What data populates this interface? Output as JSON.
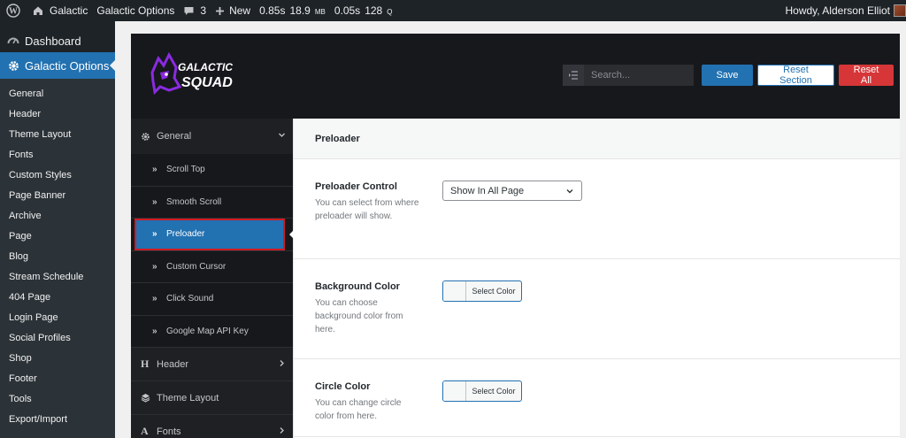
{
  "adminbar": {
    "site_name": "Galactic",
    "options_label": "Galactic Options",
    "comments_count": "3",
    "new_label": "New",
    "stats": {
      "time1": "0.85s",
      "mem_value": "18.9",
      "mem_unit": "MB",
      "time2": "0.05s",
      "queries_value": "128",
      "queries_unit": "Q"
    },
    "greeting": "Howdy, Alderson Elliot"
  },
  "adminmenu": {
    "dashboard_label": "Dashboard",
    "current_label": "Galactic Options",
    "submenu": [
      "General",
      "Header",
      "Theme Layout",
      "Fonts",
      "Custom Styles",
      "Page Banner",
      "Archive",
      "Page",
      "Blog",
      "Stream Schedule",
      "404 Page",
      "Login Page",
      "Social Profiles",
      "Shop",
      "Footer",
      "Tools",
      "Export/Import"
    ]
  },
  "panel": {
    "logo_line1": "GALACTIC",
    "logo_line2": "SQUAD",
    "search_placeholder": "Search...",
    "save_label": "Save",
    "reset_section_label": "Reset Section",
    "reset_all_label": "Reset All",
    "nav": {
      "general": "General",
      "subs": [
        "Scroll Top",
        "Smooth Scroll",
        "Preloader",
        "Custom Cursor",
        "Click Sound",
        "Google Map API Key"
      ],
      "active_sub": "Preloader",
      "header": "Header",
      "theme_layout": "Theme Layout",
      "fonts": "Fonts"
    },
    "section_title": "Preloader",
    "fields": {
      "control": {
        "title": "Preloader Control",
        "desc": "You can select from where preloader will show.",
        "value": "Show In All Page"
      },
      "bg_color": {
        "title": "Background Color",
        "desc": "You can choose background color from here.",
        "button": "Select Color"
      },
      "circle_color": {
        "title": "Circle Color",
        "desc": "You can change circle color from here.",
        "button": "Select Color"
      }
    }
  },
  "colors": {
    "adminbar_bg": "#1d2327",
    "accent": "#2271b1",
    "danger": "#d63638",
    "panel_header": "#17181c",
    "logo_purple": "#8a2be2"
  }
}
